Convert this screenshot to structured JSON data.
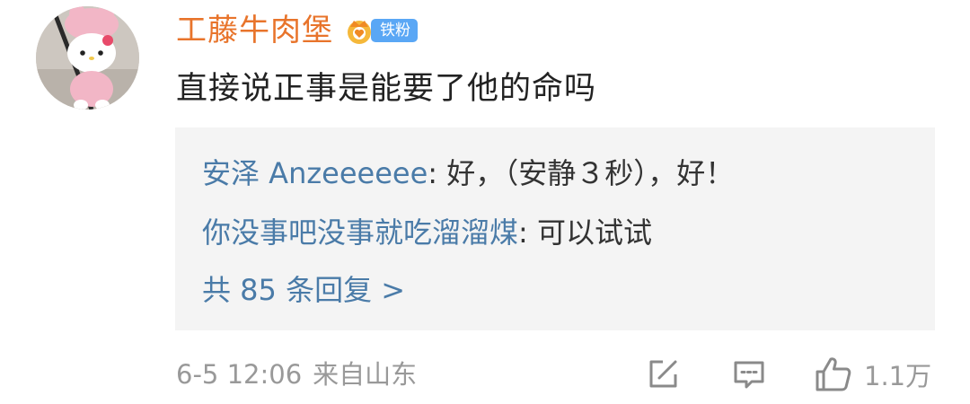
{
  "comment": {
    "username": "工藤牛肉堡",
    "badge_label": "铁粉",
    "badge_icon": "crown-icon",
    "text": "直接说正事是能要了他的命吗",
    "colors": {
      "username": "#e8742b",
      "badge": "#5aa7f5",
      "reply_author": "#4a7ba8",
      "meta": "#999999"
    }
  },
  "replies": {
    "items": [
      {
        "author": "安泽 Anzeeeeee",
        "separator": ": ",
        "text": "好，（安静３秒），好！"
      },
      {
        "author": "你没事吧没事就吃溜溜煤",
        "separator": ": ",
        "text": "可以试试"
      }
    ],
    "more_label": "共 85 条回复 >"
  },
  "footer": {
    "date": "6-5 12:06",
    "location": "来自山东",
    "share_icon": "share-icon",
    "comment_icon": "comment-icon",
    "like_icon": "thumbs-up-icon",
    "like_count": "1.1万"
  }
}
